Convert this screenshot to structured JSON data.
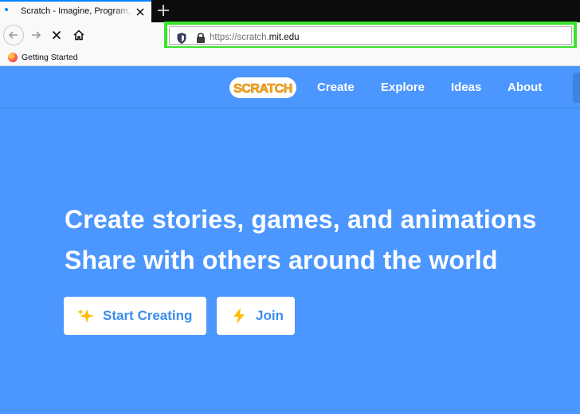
{
  "browser": {
    "tab": {
      "title": "Scratch - Imagine, Program, Sh"
    },
    "address_bar": {
      "url_prefix": "https://scratch.",
      "url_domain": "mit.edu"
    },
    "bookmarks": [
      {
        "label": "Getting Started"
      }
    ],
    "highlight_color": "#3ae32c"
  },
  "site": {
    "logo_text": "SCRATCH",
    "nav": {
      "create": "Create",
      "explore": "Explore",
      "ideas": "Ideas",
      "about": "About"
    }
  },
  "hero": {
    "line1": "Create stories, games, and animations",
    "line2": "Share with others around the world",
    "buttons": {
      "start": "Start Creating",
      "join": "Join"
    }
  },
  "colors": {
    "brand_blue": "#4c97ff",
    "button_text": "#3b8ded",
    "logo_orange": "#f9a91e"
  }
}
